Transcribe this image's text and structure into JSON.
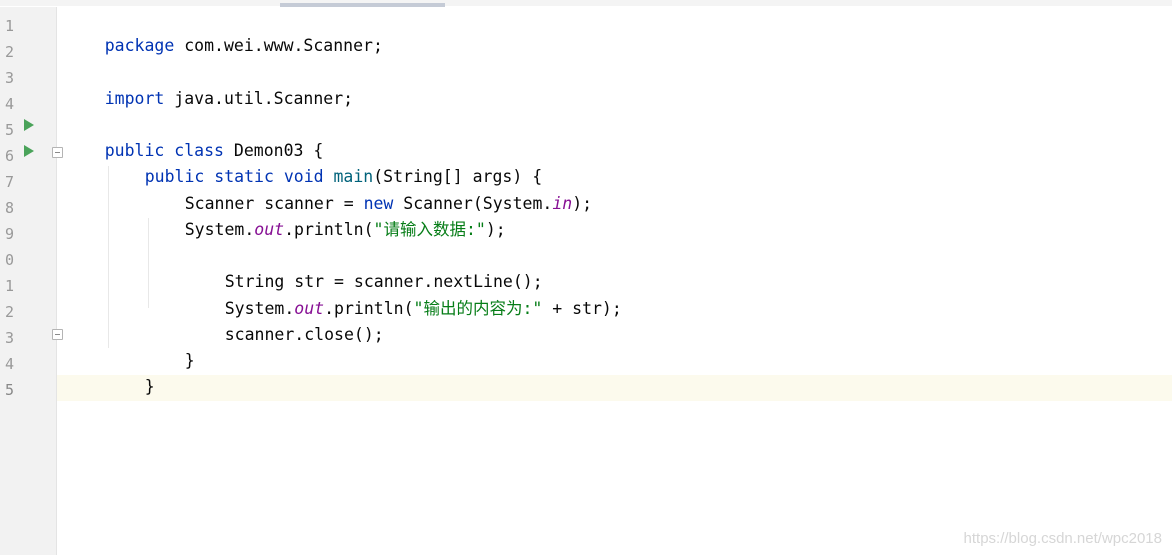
{
  "editor": {
    "line_numbers": [
      "1",
      "2",
      "3",
      "4",
      "5",
      "6",
      "7",
      "8",
      "9",
      "0",
      "1",
      "2",
      "3",
      "4",
      "5"
    ],
    "colors": {
      "keyword": "#0033b3",
      "method": "#00627a",
      "static_field": "#871094",
      "string": "#067d17",
      "run_gutter_icon": "#4aa35a",
      "current_line_highlight": "#fcfaed"
    },
    "gutter_icons": [
      "run-icon",
      "run-icon",
      "fold-icon",
      "fold-icon"
    ],
    "code": {
      "line1": {
        "kw": "package",
        "rest": " com.wei.www.Scanner;"
      },
      "line3": {
        "kw": "import",
        "rest": " java.util.Scanner;"
      },
      "line5": {
        "kw": "public class",
        "rest": " Demon03 {"
      },
      "line6": {
        "kw": "public static void",
        "method": "main",
        "rest": "(String[] args) {"
      },
      "line7": {
        "a": "Scanner scanner = ",
        "kw": "new",
        "b": " Scanner(System.",
        "field": "in",
        "c": ");"
      },
      "line8": {
        "a": "System.",
        "field": "out",
        "b": ".println(",
        "str": "\"请输入数据:\"",
        "c": ");"
      },
      "line10": {
        "text": "String str = scanner.nextLine();"
      },
      "line11": {
        "a": "System.",
        "field": "out",
        "b": ".println(",
        "str": "\"输出的内容为:\"",
        "c": " + str);"
      },
      "line12": {
        "text": "scanner.close();"
      },
      "line13": {
        "text": "}"
      },
      "line14": {
        "text": "}"
      }
    }
  },
  "watermark": "https://blog.csdn.net/wpc2018"
}
